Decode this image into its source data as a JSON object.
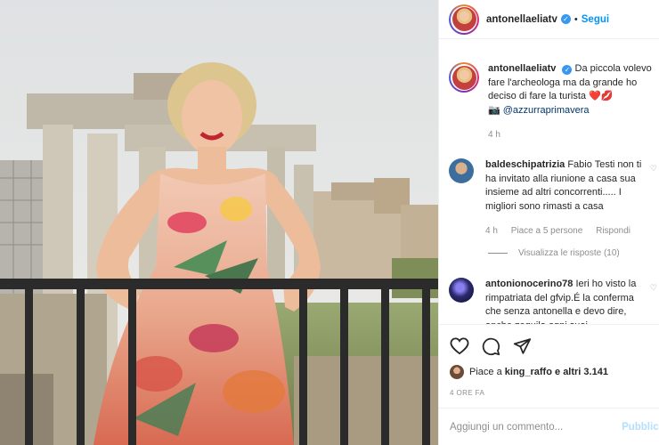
{
  "header": {
    "username": "antonellaeliatv",
    "separator": "•",
    "follow_label": "Segui"
  },
  "caption": {
    "username": "antonellaeliatv",
    "text": "Da piccola volevo fare l'archeologa ma da grande ho deciso di fare la turista",
    "emoji": "❤️💋",
    "camera_icon": "📷",
    "mention": "@azzurraprimavera",
    "time": "4 h"
  },
  "comments": [
    {
      "username": "baldeschipatrizia",
      "text": "Fabio Testi non ti ha invitato alla riunione a casa sua insieme ad altri concorrenti..... I migliori sono rimasti a casa",
      "time": "4 h",
      "likes": "Piace a 5 persone",
      "reply": "Rispondi",
      "view_replies": "Visualizza le risposte (10)"
    },
    {
      "username": "antonionocerino78",
      "text": "Ieri ho visto la rimpatriata del gfvip.É la conferma che senza antonella e devo dire, anche zequila ogni suoi"
    }
  ],
  "actions": {
    "likes_text": "Piace a",
    "likes_user": "king_raffo",
    "likes_rest": "e altri 3.141",
    "time_ago": "4 ORE FA",
    "comment_placeholder": "Aggiungi un commento...",
    "publish_label": "Pubblica"
  }
}
